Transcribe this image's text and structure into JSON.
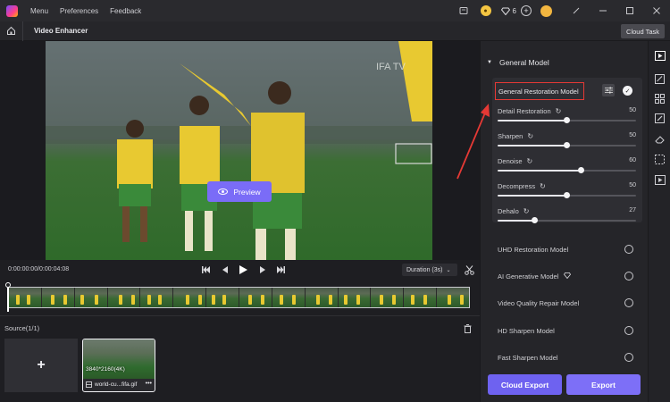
{
  "titlebar": {
    "menu": [
      "Menu",
      "Preferences",
      "Feedback"
    ],
    "gem_count": "6"
  },
  "subbar": {
    "title": "Video Enhancer",
    "cloud_task": "Cloud Task"
  },
  "preview": {
    "button_label": "Preview",
    "watermark": "IFA TV"
  },
  "controls": {
    "timecode": "0:00:00:00/0:00:04:08",
    "duration": "Duration (3s)"
  },
  "source": {
    "label": "Source(1/1)",
    "add": "+",
    "thumb_resolution": "3840*2160(4K)",
    "thumb_name": "world-cu...fifa.gif",
    "thumb_more": "•••"
  },
  "settings": {
    "section_title": "General Model",
    "active_model": "General Restoration Model",
    "params": [
      {
        "label": "Detail Restoration",
        "value": 50
      },
      {
        "label": "Sharpen",
        "value": 50
      },
      {
        "label": "Denoise",
        "value": 60
      },
      {
        "label": "Decompress",
        "value": 50
      },
      {
        "label": "Dehalo",
        "value": 27
      }
    ],
    "models": [
      "UHD Restoration Model",
      "AI Generative Model",
      "Video Quality Repair Model",
      "HD Sharpen Model",
      "Fast Sharpen Model"
    ],
    "cloud_export": "Cloud Export",
    "export": "Export"
  },
  "colors": {
    "accent": "#7d6ff7",
    "highlight_box": "#e53935"
  }
}
